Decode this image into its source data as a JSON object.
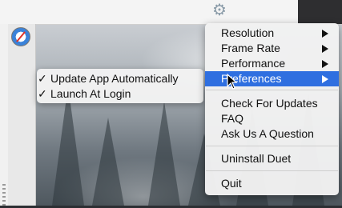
{
  "toolbar": {
    "gear_icon": "gear-icon"
  },
  "dock": {
    "app_icon": "safari-icon"
  },
  "menu": {
    "items": [
      {
        "label": "Resolution",
        "has_submenu": true
      },
      {
        "label": "Frame Rate",
        "has_submenu": true
      },
      {
        "label": "Performance",
        "has_submenu": true
      },
      {
        "label": "Preferences",
        "has_submenu": true,
        "highlighted": true
      },
      {
        "label": "Check For Updates"
      },
      {
        "label": "FAQ"
      },
      {
        "label": "Ask Us A Question"
      },
      {
        "label": "Uninstall Duet"
      },
      {
        "label": "Quit"
      }
    ],
    "highlight_color": "#2f6fe0"
  },
  "submenu": {
    "check_mark": "✓",
    "items": [
      {
        "label": "Update App Automatically",
        "checked": true
      },
      {
        "label": "Launch At Login",
        "checked": true
      }
    ]
  }
}
